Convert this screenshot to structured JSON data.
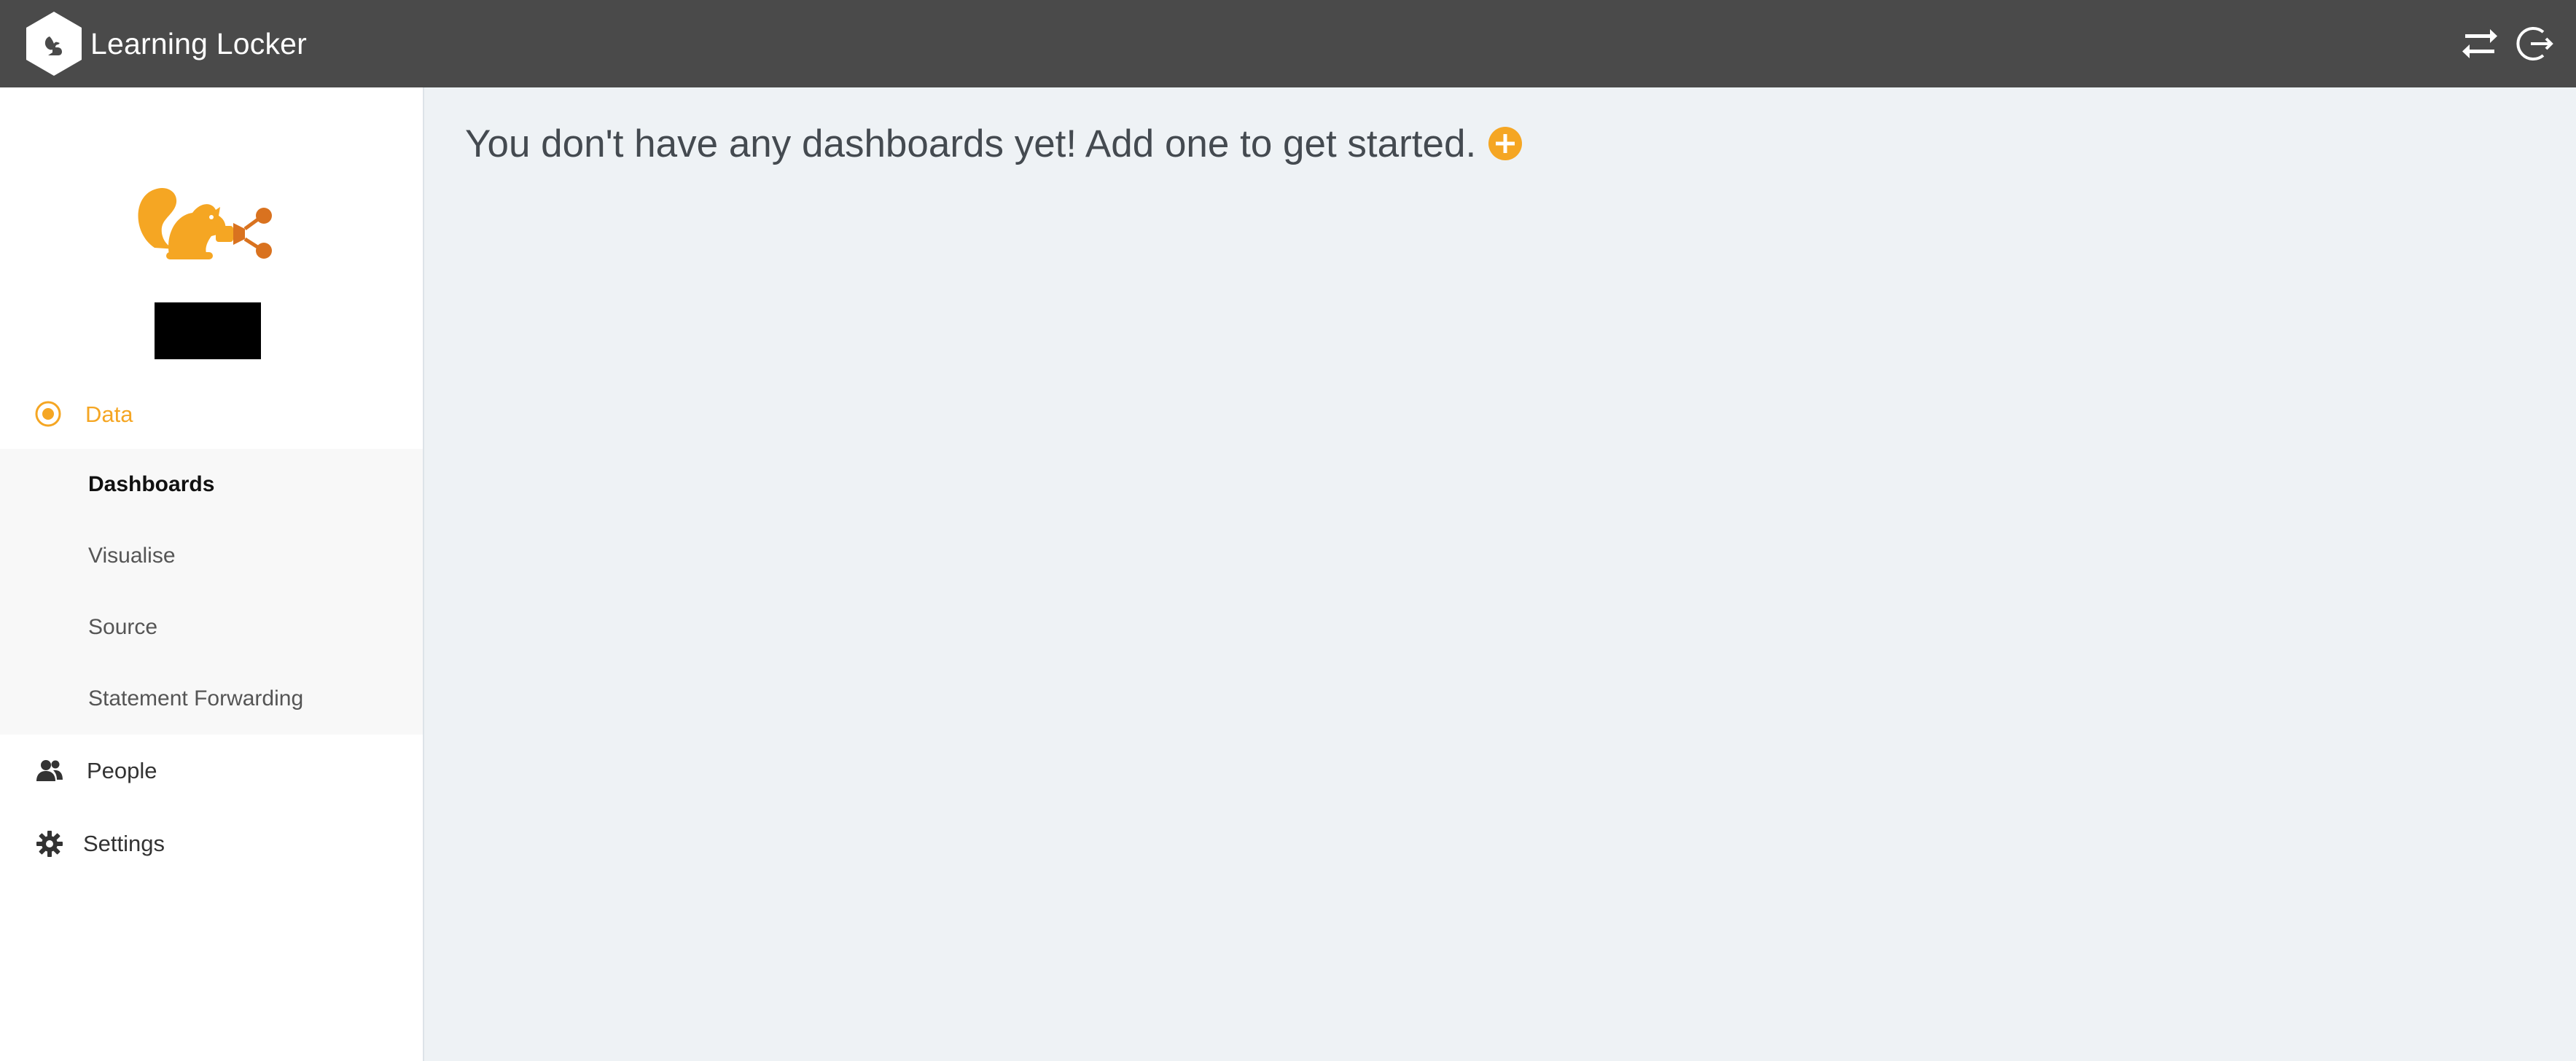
{
  "app": {
    "title": "Learning Locker"
  },
  "colors": {
    "topbar": "#4a4a4a",
    "accent": "#f5a623",
    "background": "#eef2f5",
    "sidebar": "#ffffff"
  },
  "topbar": {
    "icons": [
      {
        "name": "switch-org-icon"
      },
      {
        "name": "logout-icon"
      }
    ]
  },
  "sidebar": {
    "logo_icon": "squirrel-logo-icon",
    "org_name": "",
    "nav": {
      "data_label": "Data",
      "people_label": "People",
      "settings_label": "Settings"
    },
    "subnav": [
      {
        "label": "Dashboards",
        "active": true
      },
      {
        "label": "Visualise",
        "active": false
      },
      {
        "label": "Source",
        "active": false
      },
      {
        "label": "Statement Forwarding",
        "active": false
      }
    ]
  },
  "main": {
    "empty_message": "You don't have any dashboards yet! Add one to get started.",
    "add_icon": "plus-circle-icon"
  }
}
